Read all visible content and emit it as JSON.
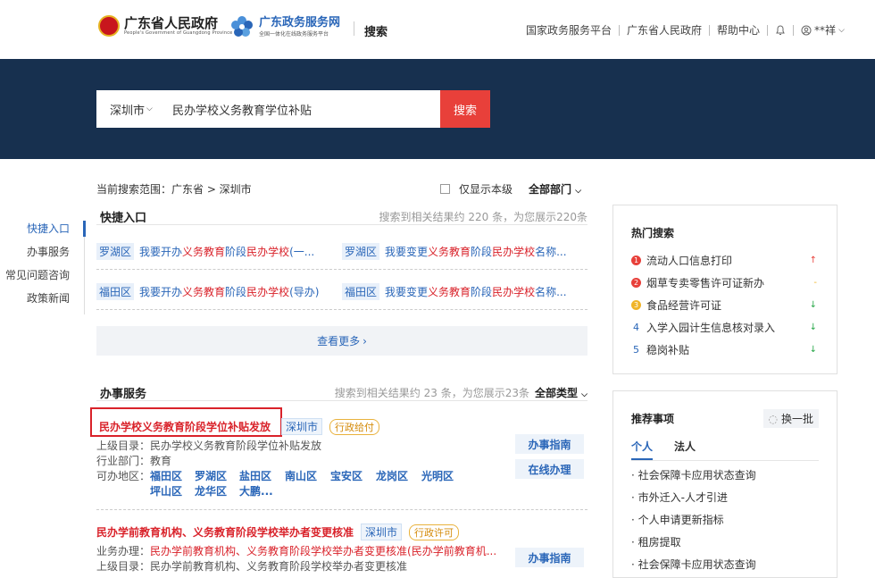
{
  "header": {
    "gov_title": "广东省人民政府",
    "gov_subtitle": "People's Government of Guangdong Province",
    "service_title": "广东政务服务网",
    "service_subtitle": "全国一体化在线政务服务平台",
    "search_label": "搜索",
    "nav": [
      "国家政务服务平台",
      "广东省人民政府",
      "帮助中心"
    ],
    "user": "**祥"
  },
  "search": {
    "city": "深圳市",
    "query": "民办学校义务教育学位补贴",
    "button": "搜索"
  },
  "leftnav": {
    "items": [
      "快捷入口",
      "办事服务",
      "常见问题咨询",
      "政策新闻"
    ]
  },
  "filters": {
    "scope": "当前搜索范围：广东省 > 深圳市",
    "only_this_level": "仅显示本级",
    "department": "全部部门"
  },
  "quick": {
    "title": "快捷入口",
    "count": "搜索到相关结果约 220 条，为您展示220条",
    "items": [
      {
        "district": "罗湖区",
        "parts": [
          "我要开办",
          "义务教育",
          "阶段",
          "民办学校",
          "(一..."
        ]
      },
      {
        "district": "罗湖区",
        "parts": [
          "我要变更",
          "义务教育",
          "阶段",
          "民办学校",
          "名称..."
        ]
      },
      {
        "district": "福田区",
        "parts": [
          "我要开办",
          "义务教育",
          "阶段",
          "民办学校",
          "(导办)"
        ]
      },
      {
        "district": "福田区",
        "parts": [
          "我要变更",
          "义务教育",
          "阶段",
          "民办学校",
          "名称..."
        ]
      }
    ],
    "more": "查看更多"
  },
  "services": {
    "title": "办事服务",
    "count": "搜索到相关结果约 23 条，为您展示23条",
    "type_filter": "全部类型",
    "item1": {
      "title": "民办学校义务教育阶段学位补贴发放",
      "city": "深圳市",
      "org": "行政给付",
      "catalog_label": "上级目录：",
      "catalog": "民办学校义务教育阶段学位补贴发放",
      "dept_label": "行业部门：",
      "dept": "教育",
      "area_label": "可办地区：",
      "areas": [
        "福田区",
        "罗湖区",
        "盐田区",
        "南山区",
        "宝安区",
        "龙岗区",
        "光明区",
        "坪山区",
        "龙华区",
        "大鹏..."
      ],
      "btn_guide": "办事指南",
      "btn_online": "在线办理"
    },
    "item2": {
      "title": "民办学前教育机构、义务教育阶段学校举办者变更核准",
      "city": "深圳市",
      "org": "行政许可",
      "biz_label": "业务办理：",
      "biz": "民办学前教育机构、义务教育阶段学校举办者变更核准(民办学前教育机...",
      "catalog_label": "上级目录：",
      "catalog": "民办学前教育机构、义务教育阶段学校举办者变更核准",
      "btn_guide": "办事指南"
    }
  },
  "hot": {
    "title": "热门搜索",
    "items": [
      {
        "rank": "1",
        "label": "流动人口信息打印",
        "trend": "up",
        "color": "#e8403a"
      },
      {
        "rank": "2",
        "label": "烟草专卖零售许可证新办",
        "trend": "flat",
        "color": "#e8403a"
      },
      {
        "rank": "3",
        "label": "食品经营许可证",
        "trend": "down",
        "color": "#f0b429"
      },
      {
        "rank": "4",
        "label": "入学入园计生信息核对录入",
        "trend": "down",
        "color": "#2a66b8"
      },
      {
        "rank": "5",
        "label": "稳岗补贴",
        "trend": "down",
        "color": "#2a66b8"
      }
    ]
  },
  "recommend": {
    "title": "推荐事项",
    "switch": "换一批",
    "tabs": [
      "个人",
      "法人"
    ],
    "items": [
      "社会保障卡应用状态查询",
      "市外迁入-人才引进",
      "个人申请更新指标",
      "租房提取",
      "社会保障卡应用状态查询"
    ]
  }
}
